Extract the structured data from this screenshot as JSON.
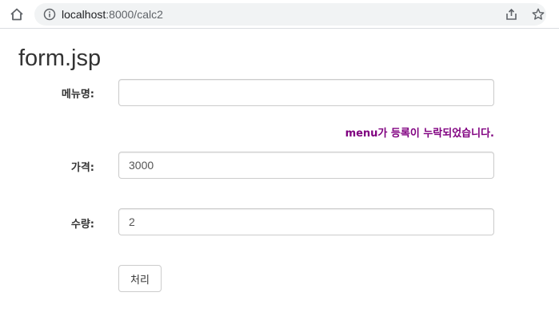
{
  "browser": {
    "url_host": "localhost",
    "url_rest": ":8000/calc2"
  },
  "page": {
    "title": "form.jsp"
  },
  "form": {
    "menu_label": "메뉴명:",
    "menu_value": "",
    "menu_error": "menu가 등록이 누락되었습니다.",
    "price_label": "가격:",
    "price_value": "3000",
    "qty_label": "수량:",
    "qty_value": "2",
    "submit_label": "처리"
  },
  "colors": {
    "error": "#800080"
  },
  "icons": [
    "home-icon",
    "info-icon",
    "share-icon",
    "star-icon"
  ]
}
